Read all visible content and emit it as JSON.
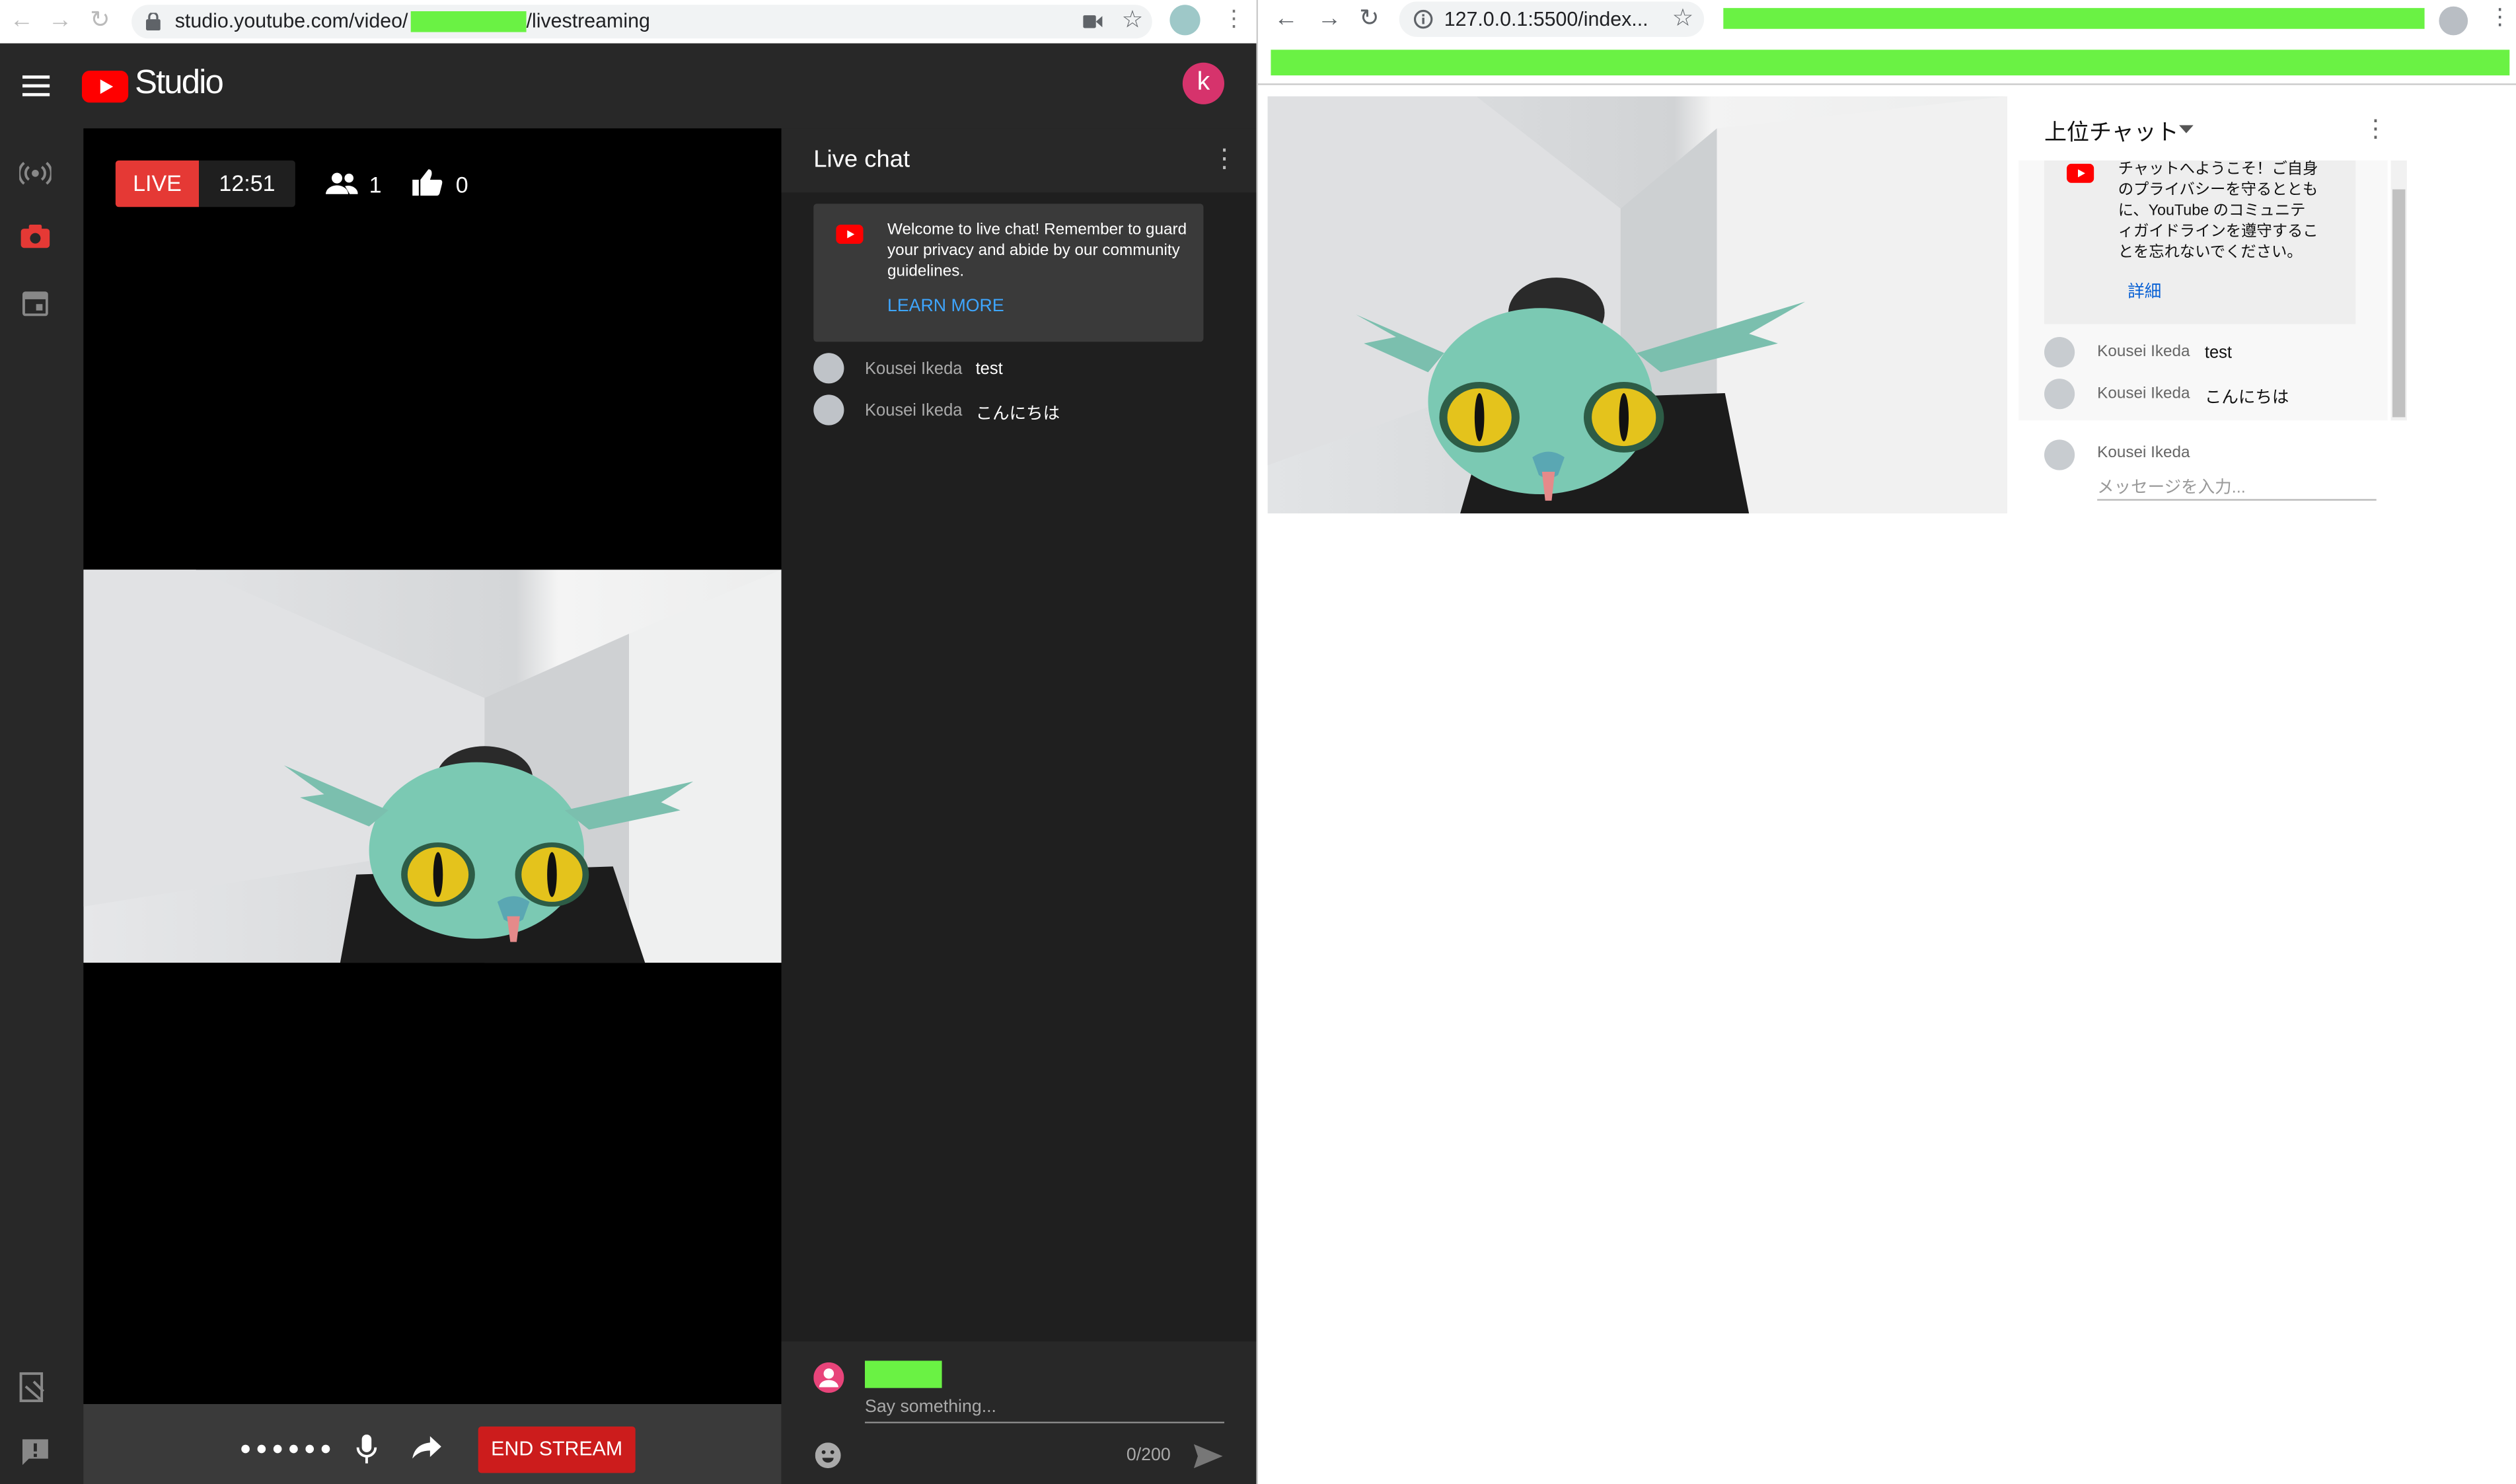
{
  "left_browser": {
    "url_prefix": "studio.youtube.com/video/",
    "url_suffix": "/livestreaming"
  },
  "studio": {
    "logo_text": "Studio",
    "avatar_letter": "k",
    "live_badge": "LIVE",
    "elapsed": "12:51",
    "viewers": "1",
    "likes": "0",
    "end_stream_label": "END STREAM",
    "chat": {
      "title": "Live chat",
      "welcome": "Welcome to live chat! Remember to guard your privacy and abide by our community guidelines.",
      "learn_more": "LEARN MORE",
      "messages": [
        {
          "author": "Kousei Ikeda",
          "text": "test"
        },
        {
          "author": "Kousei Ikeda",
          "text": "こんにちは"
        }
      ],
      "input_placeholder": "Say something...",
      "counter": "0/200"
    }
  },
  "right_browser": {
    "url": "127.0.0.1:5500/index...",
    "chat_mode": "上位チャット",
    "welcome": "チャットへようこそ！ご自身のプライバシーを守るとともに、YouTube のコミュニティガイドラインを遵守することを忘れないでください。",
    "details_link": "詳細",
    "messages": [
      {
        "author": "Kousei Ikeda",
        "text": "test"
      },
      {
        "author": "Kousei Ikeda",
        "text": "こんにちは"
      }
    ],
    "input_author": "Kousei Ikeda",
    "input_placeholder": "メッセージを入力..."
  },
  "colors": {
    "youtube_red": "#ff0000",
    "live_red": "#d93025",
    "redaction_green": "#6af244",
    "link_blue": "#3ea6ff"
  }
}
